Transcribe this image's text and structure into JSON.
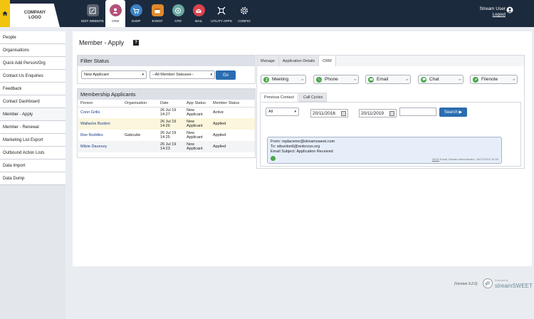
{
  "header": {
    "company_logo": "COMPANY LOGO",
    "nav": [
      {
        "label": "EDIT WEBSITE",
        "icon": "edit-website-icon",
        "color": "#5a6270",
        "active": false
      },
      {
        "label": "CRM",
        "icon": "crm-user-icon",
        "color": "#b4507a",
        "active": true
      },
      {
        "label": "SHOP",
        "icon": "shop-cart-icon",
        "color": "#3b82c4",
        "active": false
      },
      {
        "label": "EVENT",
        "icon": "event-calendar-icon",
        "color": "#e08a2a",
        "active": false
      },
      {
        "label": "CPD",
        "icon": "cpd-icon",
        "color": "#6aa8a0",
        "active": false
      },
      {
        "label": "MAIL",
        "icon": "mail-icon",
        "color": "#d9434e",
        "active": false
      },
      {
        "label": "UTILITY APPS",
        "icon": "utility-apps-icon",
        "color": "#1c2a3e",
        "active": false
      },
      {
        "label": "CONFIG",
        "icon": "config-gear-icon",
        "color": "#1c2a3e",
        "active": false
      }
    ],
    "user_name": "Stream User",
    "logout": "Logout"
  },
  "sidebar": {
    "items": [
      {
        "label": "People",
        "active": false
      },
      {
        "label": "Organisations",
        "active": false
      },
      {
        "label": "Quick Add Person/Org",
        "active": false
      },
      {
        "label": "Contact-Us Enquiries",
        "active": false
      },
      {
        "label": "Feedback",
        "active": false
      },
      {
        "label": "Contact Dashboard",
        "active": false
      },
      {
        "label": "Member - Apply",
        "active": true
      },
      {
        "label": "Member - Renewal",
        "active": false
      },
      {
        "label": "Marketing List Export",
        "active": false
      },
      {
        "label": "Outbound Action Lists",
        "active": false
      },
      {
        "label": "Data Import",
        "active": false
      },
      {
        "label": "Data Dump",
        "active": false
      }
    ]
  },
  "main": {
    "title": "Member - Apply",
    "help": "?",
    "filter": {
      "heading": "Filter Status",
      "status_select": "New Applicant",
      "member_status_select": "--All Member Statuses--",
      "go": "Go"
    },
    "applicants": {
      "heading": "Membership Applicants",
      "columns": [
        "Person",
        "Organisation",
        "Date",
        "App Status",
        "Member Status"
      ],
      "rows": [
        {
          "person": "Conn Grills",
          "org": "",
          "date": "26 Jul 19 14:27",
          "app_status": "New Applicant",
          "member_status": "Active"
        },
        {
          "person": "Wallache Burdon",
          "org": "",
          "date": "26 Jul 19 14:26",
          "app_status": "New Applicant",
          "member_status": "Applied"
        },
        {
          "person": "Ree Noddles",
          "org": "Gabcube",
          "date": "26 Jul 19 14:25",
          "app_status": "New Applicant",
          "member_status": "Applied"
        },
        {
          "person": "Milzie Dauncey",
          "org": "",
          "date": "26 Jul 19 14:23",
          "app_status": "New Applicant",
          "member_status": "Applied"
        }
      ]
    },
    "crm": {
      "tabs": [
        {
          "label": "Manage",
          "active": false
        },
        {
          "label": "Application Details",
          "active": false
        },
        {
          "label": "CRM",
          "active": true
        }
      ],
      "actions": [
        "Meeting",
        "Phone",
        "Email",
        "Chat",
        "Filenote"
      ],
      "subtabs": [
        {
          "label": "Previous Contact",
          "active": true
        },
        {
          "label": "Call Cycles",
          "active": false
        }
      ],
      "type_select": "All",
      "date_from": "20/11/2016",
      "date_to": "20/11/2019",
      "search": "Search ▶",
      "contact": {
        "from": "From: replaceme@streamsweet.com",
        "to": "To: wburdon6@redcross.org",
        "subject": "Email Subject: Application Received",
        "view": "VIEW",
        "meta": "Email, Master Administrator, 26/07/2019 14:26"
      }
    }
  },
  "footer": {
    "version": "(Version 9.2.0)",
    "powered": "Powered by",
    "brand": "streamSWEET"
  }
}
